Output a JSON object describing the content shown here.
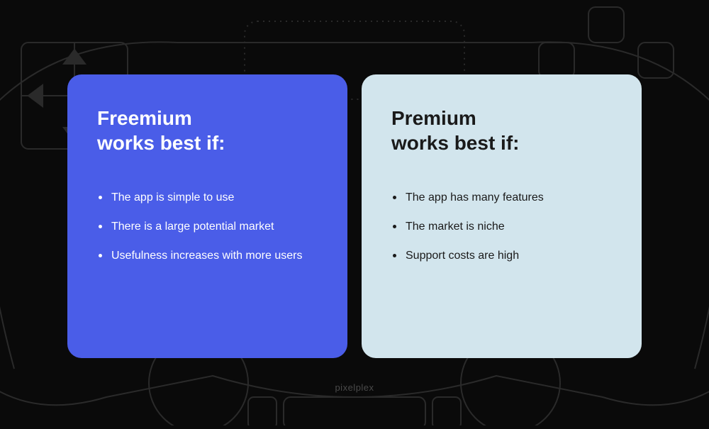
{
  "cards": {
    "freemium": {
      "title_line1": "Freemium",
      "title_line2": "works best if:",
      "items": [
        "The app is simple to use",
        "There is a large potential market",
        "Usefulness increases with more users"
      ]
    },
    "premium": {
      "title_line1": "Premium",
      "title_line2": "works best if:",
      "items": [
        "The app has many features",
        "The market is niche",
        "Support costs are high"
      ]
    }
  },
  "watermark": "pixelplex",
  "colors": {
    "freemium_bg": "#4a5de8",
    "premium_bg": "#d2e5ed",
    "page_bg": "#0a0a0a"
  }
}
